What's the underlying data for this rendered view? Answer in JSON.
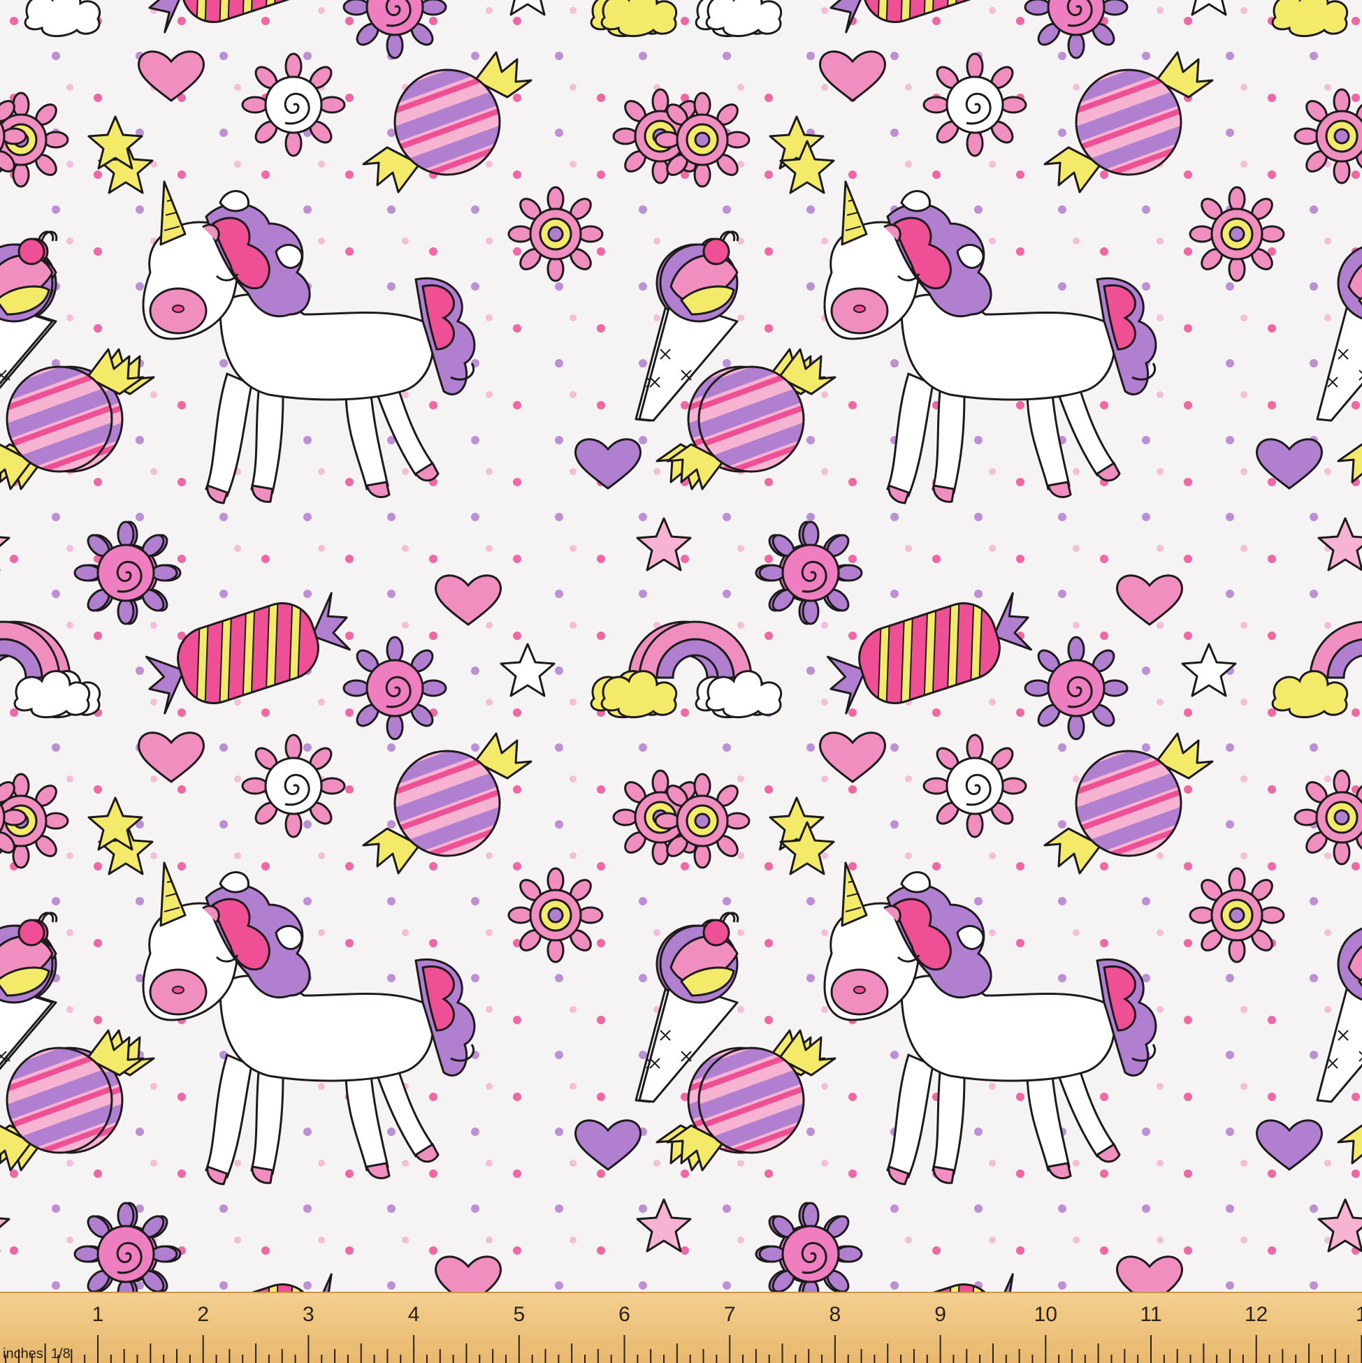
{
  "fabric": {
    "description_name": "unicorn-candy-fabric-pattern",
    "colors": {
      "background": "#f5f3f4",
      "outline": "#1d1a1c",
      "pink": "#f08fbf",
      "hot_pink": "#ee4f95",
      "light_pink": "#f6b3d2",
      "purple": "#b17fd0",
      "yellow": "#f4ea6a",
      "white": "#ffffff"
    },
    "motifs": [
      "unicorn-icon",
      "candy-icon",
      "star-icon",
      "heart-icon",
      "lollipop-icon",
      "flower-icon",
      "rainbow-icon",
      "cloud-icon",
      "ice-cream-icon",
      "dot-icon"
    ]
  },
  "ruler": {
    "units_label": "inches, 1/8",
    "numbers": [
      "1",
      "2",
      "3",
      "4",
      "5",
      "6",
      "7",
      "8",
      "9",
      "10",
      "11",
      "12",
      "1"
    ]
  }
}
